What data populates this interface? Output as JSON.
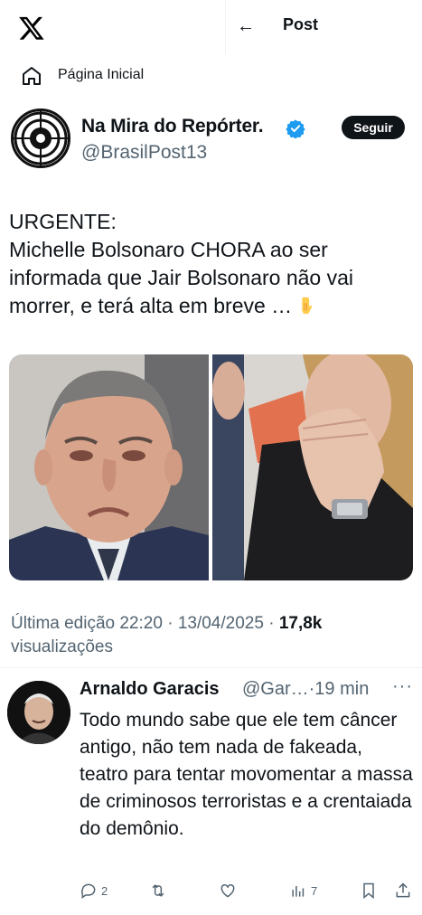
{
  "header": {
    "title": "Post",
    "back_icon": "arrow-left-icon",
    "logo_icon": "x-logo-icon"
  },
  "nav": {
    "home_label": "Página Inicial",
    "home_icon": "home-icon"
  },
  "post": {
    "author_name": "Na Mira do Repórter.",
    "author_handle": "@BrasilPost13",
    "follow_label": "Seguir",
    "text_lines": [
      "URGENTE:",
      "Michelle Bolsonaro CHORA ao ser",
      "informada que Jair Bolsonaro não vai",
      "morrer, e terá alta em breve …"
    ],
    "edited_label": "Última edição 22:20 · 13/04/2025",
    "separator": " · ",
    "views_count": "17,8k",
    "views_label": "visualizações"
  },
  "reply": {
    "name": "Arnaldo Garacis",
    "handle_time": "@Gar…·19 min",
    "more": "···",
    "text": "Todo mundo sabe que ele tem câncer antigo, não tem nada de fakeada, teatro para tentar movomentar a massa de criminosos terroristas e a crentaiada do demônio.",
    "replies": "2",
    "views": "7"
  },
  "colors": {
    "verified": "#1d9bf0",
    "muted": "#536471",
    "text": "#0f1419"
  }
}
